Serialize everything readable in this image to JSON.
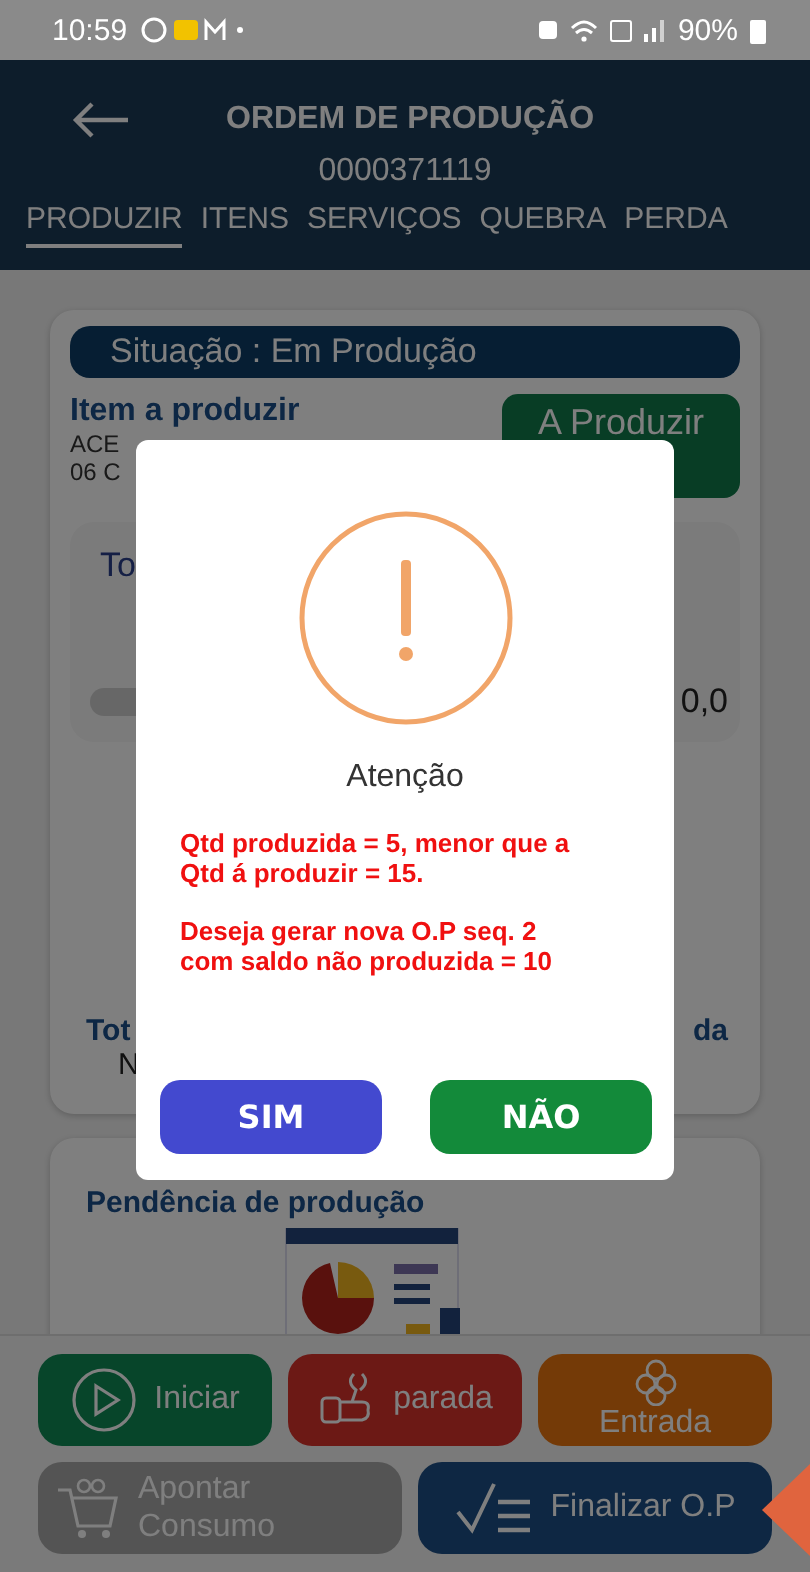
{
  "status_bar": {
    "time": "10:59",
    "battery": "90%"
  },
  "header": {
    "title": "ORDEM DE PRODUÇÃO",
    "number": "0000371119"
  },
  "tabs": [
    {
      "label": "PRODUZIR",
      "selected": true
    },
    {
      "label": "ITENS",
      "selected": false
    },
    {
      "label": "SERVIÇOS",
      "selected": false
    },
    {
      "label": "QUEBRA",
      "selected": false
    },
    {
      "label": "PERDA",
      "selected": false
    }
  ],
  "order_card": {
    "status": "Situação : Em Produção",
    "item_title": "Item a produzir",
    "item_lines": [
      "ACE",
      "06 C"
    ],
    "status_button": "A Produzir"
  },
  "progress_card": {
    "title": "To",
    "value": "0,0"
  },
  "totals": {
    "left_label": "Tot",
    "left_value": "N",
    "right_label": "da"
  },
  "pending_card": {
    "title": "Pendência de produção"
  },
  "actions": [
    {
      "kind": "start",
      "label": "Iniciar"
    },
    {
      "kind": "stop",
      "label": "parada"
    },
    {
      "kind": "input",
      "label": "Entrada"
    },
    {
      "kind": "consume",
      "label": "Apontar Consumo"
    },
    {
      "kind": "finish",
      "label": "Finalizar O.P"
    }
  ],
  "dialog": {
    "title": "Atenção",
    "messages": [
      "Qtd produzida = 5, menor que a Qtd á produzir = 15.",
      "Deseja gerar nova O.P seq. 2 com saldo não produzida = 10"
    ],
    "buttons": [
      {
        "kind": "confirm",
        "label": "SIM"
      },
      {
        "kind": "cancel",
        "label": "NÃO"
      }
    ]
  }
}
